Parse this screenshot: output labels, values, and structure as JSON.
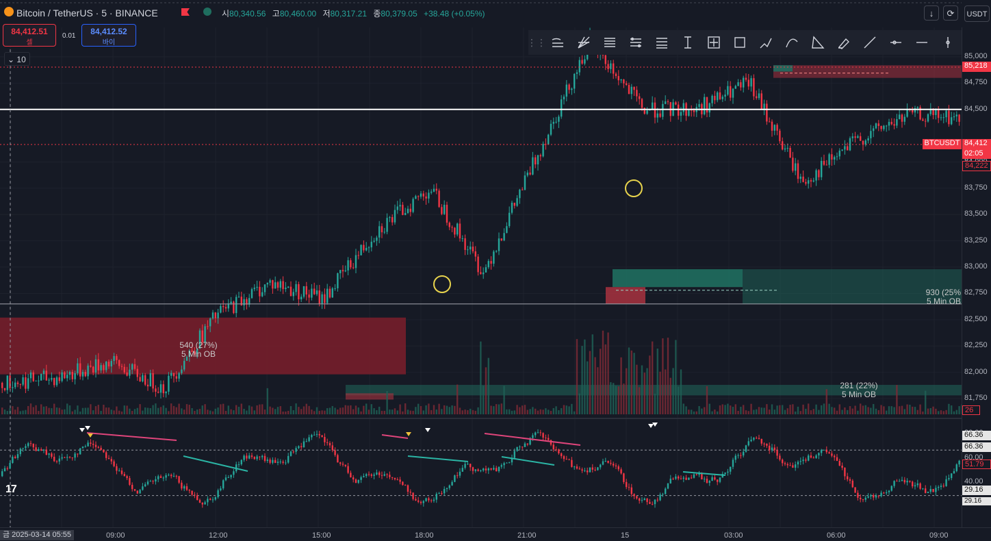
{
  "header": {
    "symbol_title": "Bitcoin / TetherUS · 5 · BINANCE",
    "ohlc": {
      "open_label": "시",
      "open": "80,340.56",
      "high_label": "고",
      "high": "80,460.00",
      "low_label": "저",
      "low": "80,317.21",
      "close_label": "종",
      "close": "80,379.05",
      "change": "+38.48 (+0.05%)"
    },
    "currency": "USDT"
  },
  "trade": {
    "sell_price": "84,412.51",
    "sell_label": "셀",
    "spread": "0.01",
    "buy_price": "84,412.52",
    "buy_label": "바이"
  },
  "indicator_count": "10",
  "drawing_tools": [
    "multi-line-icon",
    "pitchfan-icon",
    "fib-retracement-icon",
    "parallel-channel-icon",
    "disjoint-channel-icon",
    "price-range-icon",
    "date-price-range-icon",
    "rectangle-icon",
    "path-icon",
    "curve-icon",
    "triangle-icon",
    "brush-icon",
    "trend-line-icon",
    "horizontal-ray-icon",
    "horizontal-line-icon",
    "vertical-line-icon",
    "text-icon"
  ],
  "price_axis": [
    "85,000",
    "84,750",
    "84,500",
    "84,000",
    "83,750",
    "83,500",
    "83,250",
    "83,000",
    "82,750",
    "82,500",
    "82,250",
    "82,000",
    "81,750"
  ],
  "price_tags": {
    "high_tag": "85,218",
    "symbol_tag": "BTCUSDT",
    "last_price": "84,412",
    "countdown": "02:05",
    "prev_price": "84,222",
    "volume_tag": "26"
  },
  "oscillator_axis": [
    "80.00",
    "60.00",
    "40.00"
  ],
  "oscillator_tags": [
    "66.36",
    "66.36",
    "51.79",
    "29.16",
    "29.16"
  ],
  "order_blocks": [
    {
      "size": "540 (27%)",
      "label": "5 Min OB"
    },
    {
      "size": "930 (25%",
      "label": "5 Min OB"
    },
    {
      "size": "281 (22%)",
      "label": "5 Min OB"
    }
  ],
  "time_axis": {
    "cursor_date": "금 2025-03-14  05:55",
    "ticks": [
      "09:00",
      "12:00",
      "15:00",
      "18:00",
      "21:00",
      "15",
      "03:00",
      "06:00",
      "09:00"
    ]
  },
  "colors": {
    "up": "#26a69a",
    "down": "#f23645",
    "bg": "#161a25",
    "ob_bear": "#7b1f2b",
    "ob_bull": "#1f6e5f",
    "highlight_circle": "#e8d44d"
  },
  "chart_data": {
    "type": "candlestick",
    "symbol": "BTCUSDT",
    "interval": "5",
    "ylim": [
      81600,
      85280
    ],
    "price_key_points": [
      {
        "time": "06:00",
        "price": 81900
      },
      {
        "time": "09:30",
        "price": 81950
      },
      {
        "time": "12:00",
        "price": 82100
      },
      {
        "time": "15:00",
        "price": 81850
      },
      {
        "time": "17:30",
        "price": 82550
      },
      {
        "time": "18:30",
        "price": 82850
      },
      {
        "time": "19:00",
        "price": 82700
      },
      {
        "time": "21:00",
        "price": 83350
      },
      {
        "time": "22:00",
        "price": 83750
      },
      {
        "time": "22:45",
        "price": 82950
      },
      {
        "time": "23:30",
        "price": 84050
      },
      {
        "time": "00:30",
        "price": 85150
      },
      {
        "time": "01:30",
        "price": 84500
      },
      {
        "time": "03:00",
        "price": 84500
      },
      {
        "time": "04:30",
        "price": 84750
      },
      {
        "time": "05:30",
        "price": 83800
      },
      {
        "time": "06:30",
        "price": 84200
      },
      {
        "time": "08:30",
        "price": 84450
      },
      {
        "time": "09:30",
        "price": 84412
      }
    ],
    "horizontal_lines": [
      84500,
      82650
    ],
    "oscillator_range": [
      20,
      90
    ]
  }
}
